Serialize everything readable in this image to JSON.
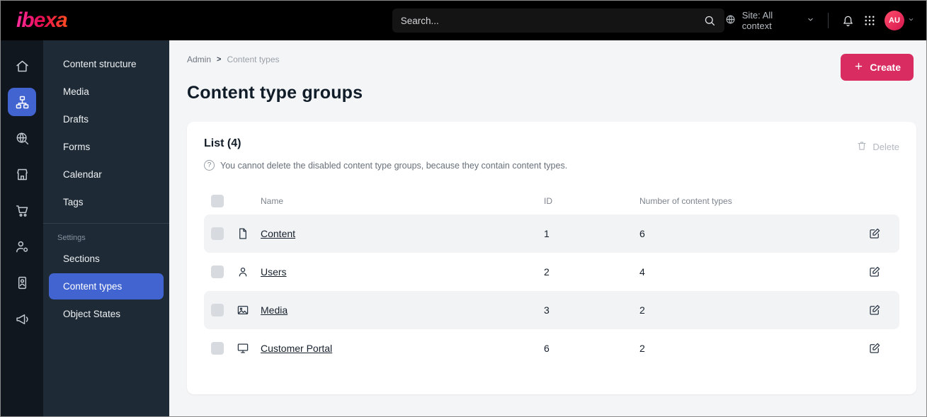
{
  "topbar": {
    "logo": "ibexa",
    "search_placeholder": "Search...",
    "site_context": "Site: All context",
    "avatar_initials": "AU",
    "icons": [
      "search",
      "globe",
      "chevron-down",
      "bell",
      "app-grid"
    ]
  },
  "rail": {
    "icons": [
      "home",
      "content-structure",
      "search-globe",
      "storefront",
      "cart",
      "user-settings",
      "badge",
      "megaphone"
    ],
    "active_index": 1
  },
  "sidebar": {
    "items": [
      "Content structure",
      "Media",
      "Drafts",
      "Forms",
      "Calendar",
      "Tags"
    ],
    "settings_label": "Settings",
    "settings_items": [
      "Sections",
      "Content types",
      "Object States"
    ],
    "active_item": "Content types"
  },
  "main": {
    "breadcrumb": {
      "root": "Admin",
      "sep": ">",
      "current": "Content types"
    },
    "create_label": "Create",
    "title": "Content type groups",
    "card": {
      "list_title": "List (4)",
      "help_icon": "?",
      "help_text": "You cannot delete the disabled content type groups, because they contain content types.",
      "delete_label": "Delete",
      "columns": {
        "name": "Name",
        "id": "ID",
        "count": "Number of content types"
      },
      "rows": [
        {
          "icon": "content-file",
          "name": "Content",
          "id": "1",
          "count": "6"
        },
        {
          "icon": "users",
          "name": "Users",
          "id": "2",
          "count": "4"
        },
        {
          "icon": "media-image",
          "name": "Media",
          "id": "3",
          "count": "2"
        },
        {
          "icon": "customer-portal",
          "name": "Customer Portal",
          "id": "6",
          "count": "2"
        }
      ]
    }
  },
  "colors": {
    "accent": "#d92d62",
    "active": "#4264d0"
  }
}
